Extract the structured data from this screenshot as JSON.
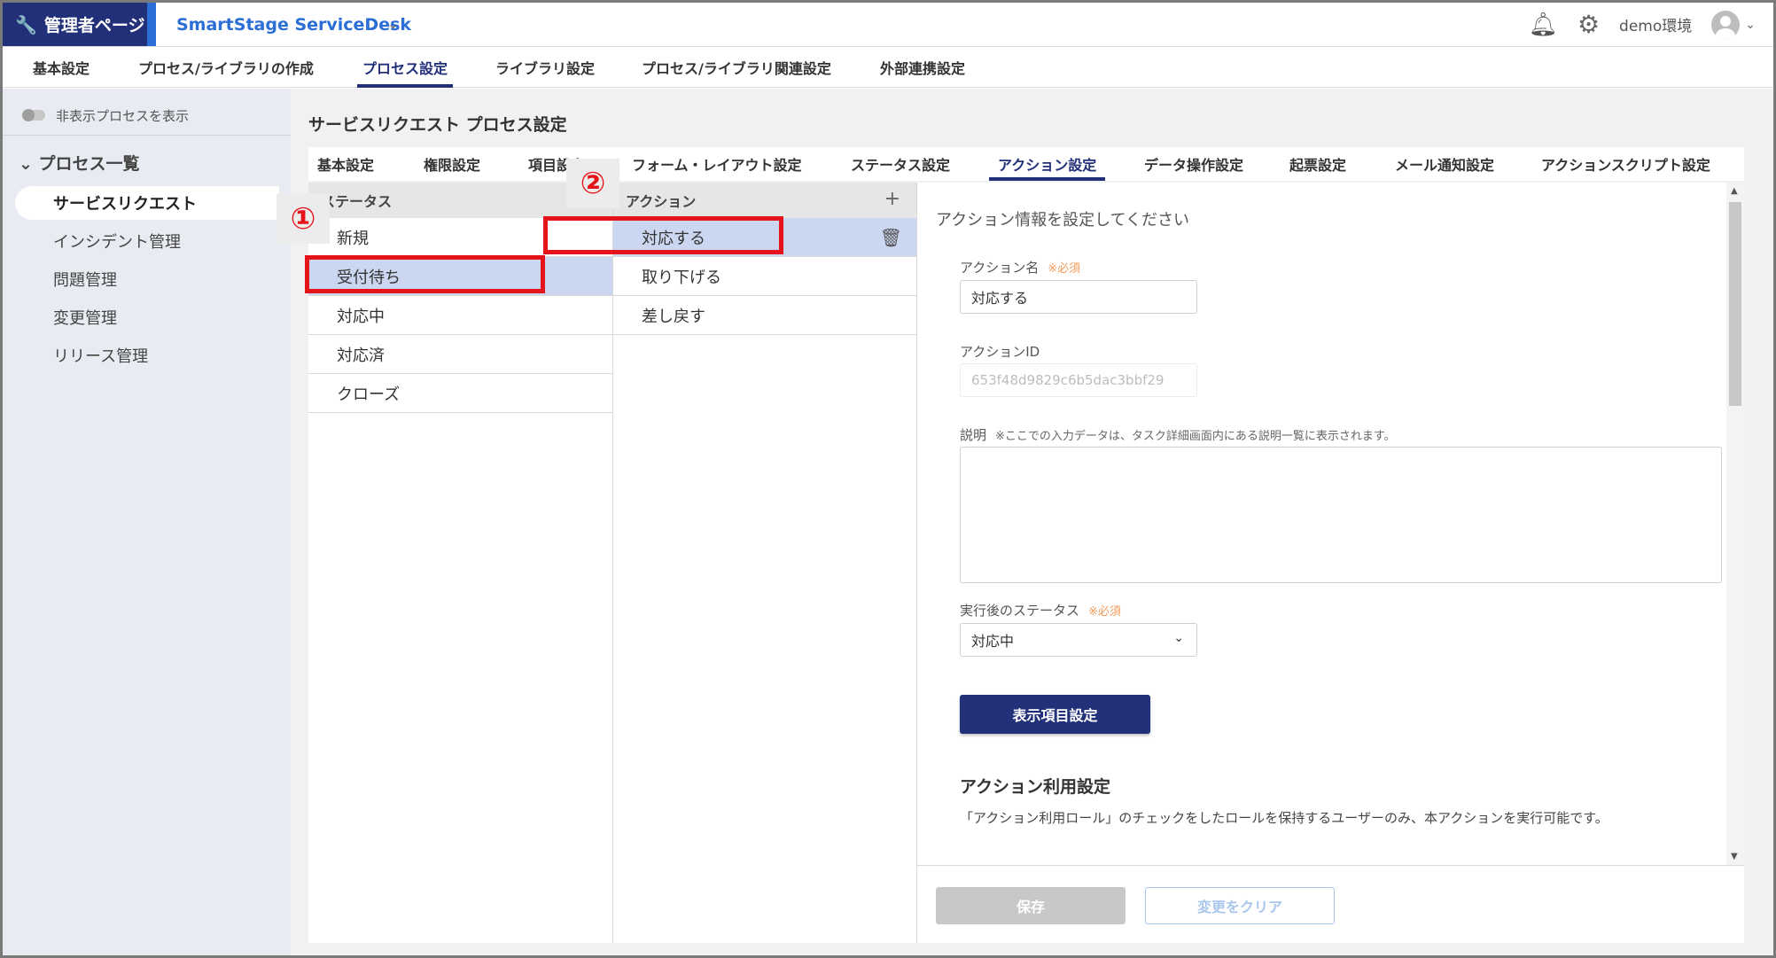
{
  "header": {
    "admin_label": "管理者ページ",
    "app_name": "SmartStage ServiceDesk",
    "env_label": "demo環境"
  },
  "topnav": {
    "items": [
      "基本設定",
      "プロセス/ライブラリの作成",
      "プロセス設定",
      "ライブラリ設定",
      "プロセス/ライブラリ関連設定",
      "外部連携設定"
    ],
    "active_index": 2
  },
  "sidebar": {
    "toggle_label": "非表示プロセスを表示",
    "section_title": "プロセス一覧",
    "items": [
      "サービスリクエスト",
      "インシデント管理",
      "問題管理",
      "変更管理",
      "リリース管理"
    ],
    "active_index": 0
  },
  "main": {
    "page_title": "サービスリクエスト プロセス設定",
    "tabs": [
      "基本設定",
      "権限設定",
      "項目設定",
      "フォーム・レイアウト設定",
      "ステータス設定",
      "アクション設定",
      "データ操作設定",
      "起票設定",
      "メール通知設定",
      "アクションスクリプト設定"
    ],
    "active_tab_index": 5
  },
  "status_column": {
    "header": "ステータス",
    "items": [
      "新規",
      "受付待ち",
      "対応中",
      "対応済",
      "クローズ"
    ],
    "selected_index": 1
  },
  "action_column": {
    "header": "アクション",
    "add_symbol": "+",
    "items": [
      "対応する",
      "取り下げる",
      "差し戻す"
    ],
    "selected_index": 0
  },
  "markers": [
    "①",
    "②"
  ],
  "detail": {
    "intro": "アクション情報を設定してください",
    "action_name_label": "アクション名",
    "required_mark": "※必須",
    "action_name_value": "対応する",
    "action_id_label": "アクションID",
    "action_id_value": "653f48d9829c6b5dac3bbf29",
    "description_label": "説明",
    "description_note": "※ここでの入力データは、タスク詳細画面内にある説明一覧に表示されます。",
    "description_value": "",
    "post_status_label": "実行後のステータス",
    "post_status_value": "対応中",
    "display_items_button": "表示項目設定",
    "usage_section_title": "アクション利用設定",
    "usage_section_desc": "「アクション利用ロール」のチェックをしたロールを保持するユーザーのみ、本アクションを実行可能です。"
  },
  "footer": {
    "save_label": "保存",
    "clear_label": "変更をクリア"
  },
  "colors": {
    "brand_navy": "#22307a",
    "brand_blue": "#2b6fd6",
    "highlight_red": "#e5131a",
    "selected_row": "#cbd6f0",
    "required_orange": "#f39b5a"
  }
}
